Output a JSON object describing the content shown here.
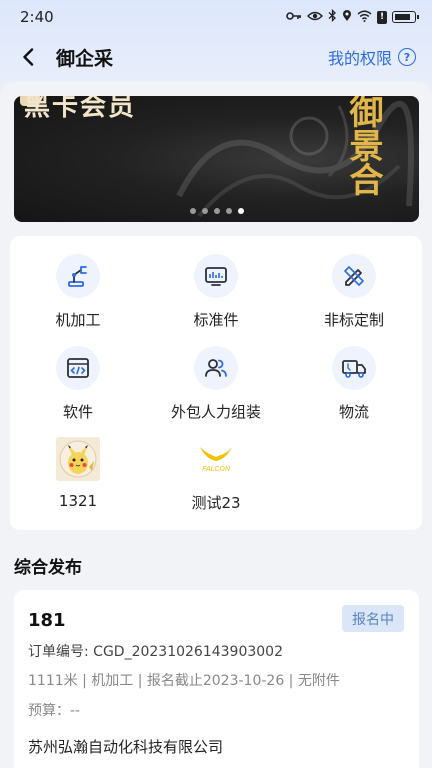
{
  "status_bar": {
    "time": "2:40"
  },
  "nav": {
    "title": "御企采",
    "right_label": "我的权限",
    "help_icon": "?"
  },
  "banner": {
    "left_text": "黑卡会员",
    "calligraphy": "御景合",
    "slide_count": 5,
    "active_slide": 4
  },
  "categories": [
    {
      "label": "机加工",
      "icon": "robot-arm-icon"
    },
    {
      "label": "标准件",
      "icon": "monitor-icon"
    },
    {
      "label": "非标定制",
      "icon": "pencil-ruler-icon"
    },
    {
      "label": "软件",
      "icon": "code-window-icon"
    },
    {
      "label": "外包人力组装",
      "icon": "people-icon"
    },
    {
      "label": "物流",
      "icon": "truck-icon"
    },
    {
      "label": "1321",
      "icon": "pikachu-thumbnail"
    },
    {
      "label": "测试23",
      "icon": "falcon-logo"
    }
  ],
  "section": {
    "title": "综合发布"
  },
  "order": {
    "title": "181",
    "status": "报名中",
    "number": "订单编号: CGD_20231026143903002",
    "meta": "1111米 | 机加工 | 报名截止2023-10-26 | 无附件",
    "budget": "预算：--",
    "company": "苏州弘瀚自动化科技有限公司"
  },
  "colors": {
    "accent": "#2e6be6",
    "icon_bg": "#eef3fd",
    "status_badge_bg": "#dbe7f8",
    "status_badge_text": "#5a83c2",
    "banner_gold": "#e2b64a",
    "falcon_yellow": "#f2c200"
  }
}
